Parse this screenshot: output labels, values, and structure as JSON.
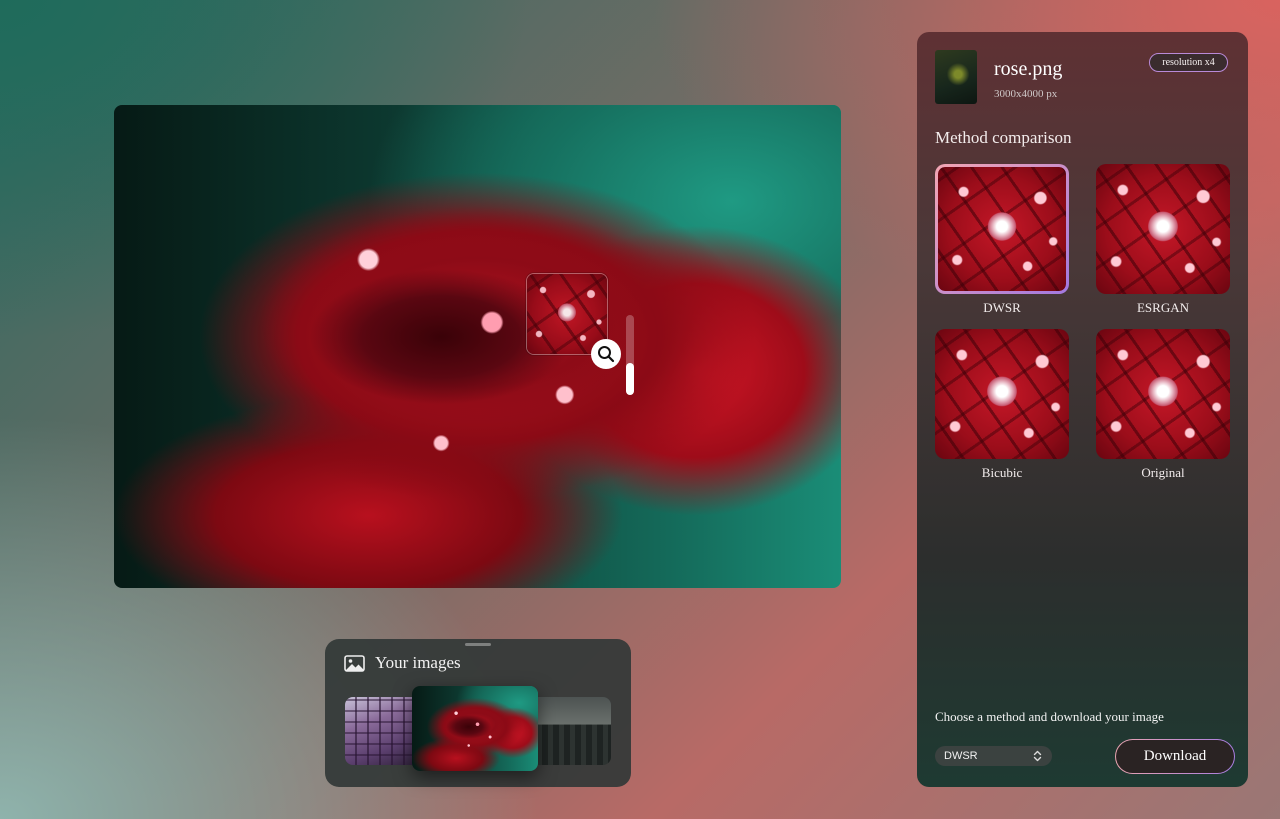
{
  "file": {
    "name": "rose.png",
    "dimensions": "3000x4000 px",
    "badge": "resolution x4"
  },
  "comparison": {
    "title": "Method comparison",
    "methods": [
      {
        "label": "DWSR",
        "selected": true
      },
      {
        "label": "ESRGAN",
        "selected": false
      },
      {
        "label": "Bicubic",
        "selected": false
      },
      {
        "label": "Original",
        "selected": false
      }
    ]
  },
  "download": {
    "prompt": "Choose a method and download your image",
    "selected_method": "DWSR",
    "button_label": "Download"
  },
  "gallery": {
    "title": "Your images",
    "icons": {
      "header": "image-icon"
    }
  },
  "preview": {
    "zoom_level": 0.4,
    "icons": {
      "zoom": "search-icon"
    }
  },
  "colors": {
    "accent_start": "#e9a4b0",
    "accent_end": "#a87de0"
  }
}
